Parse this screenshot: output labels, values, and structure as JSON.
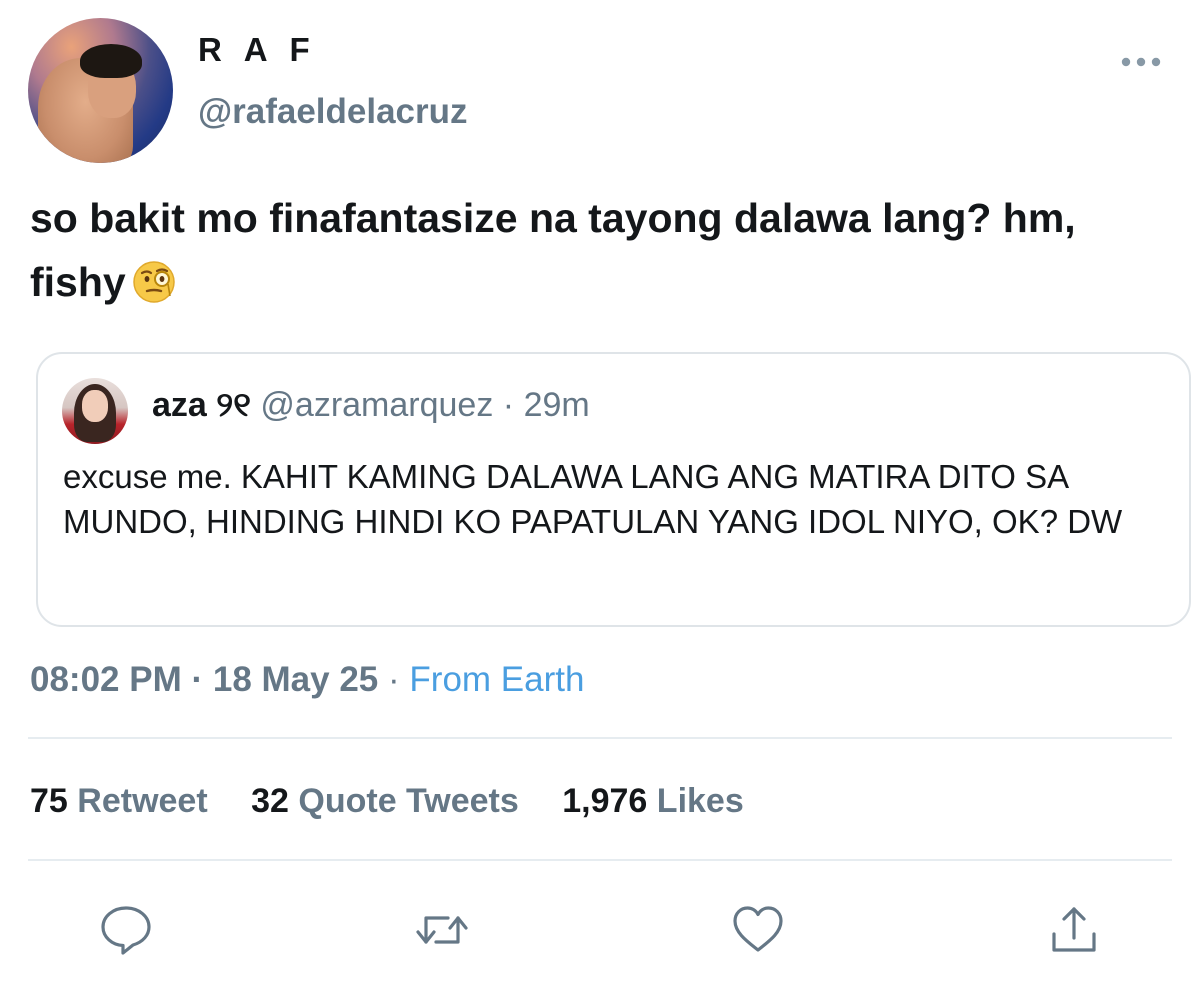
{
  "author": {
    "display_name": "R A F",
    "handle": "@rafaeldelacruz"
  },
  "tweet": {
    "text": "so bakit mo finafantasize na tayong dalawa lang? hm, fishy",
    "emoji_icon": "face-with-monocle-icon"
  },
  "quoted_tweet": {
    "name": "aza",
    "name_suffix": "୨୧",
    "handle": "@azramarquez",
    "separator": "·",
    "time": "29m",
    "text": "excuse me. KAHIT KAMING DALAWA LANG ANG MATIRA DITO SA MUNDO, HINDING HINDI KO PAPATULAN YANG IDOL NIYO, OK? DW"
  },
  "meta": {
    "time": "08:02 PM",
    "separator": "·",
    "date": "18 May 25",
    "source": "From Earth"
  },
  "stats": {
    "retweets": {
      "count": "75",
      "label": "Retweet"
    },
    "quotes": {
      "count": "32",
      "label": "Quote Tweets"
    },
    "likes": {
      "count": "1,976",
      "label": "Likes"
    }
  },
  "actions": [
    "reply-icon",
    "retweet-icon",
    "like-icon",
    "share-icon"
  ],
  "colors": {
    "text": "#14171a",
    "secondary": "#657786",
    "link": "#4a9ee0",
    "border": "#dfe4e8"
  }
}
